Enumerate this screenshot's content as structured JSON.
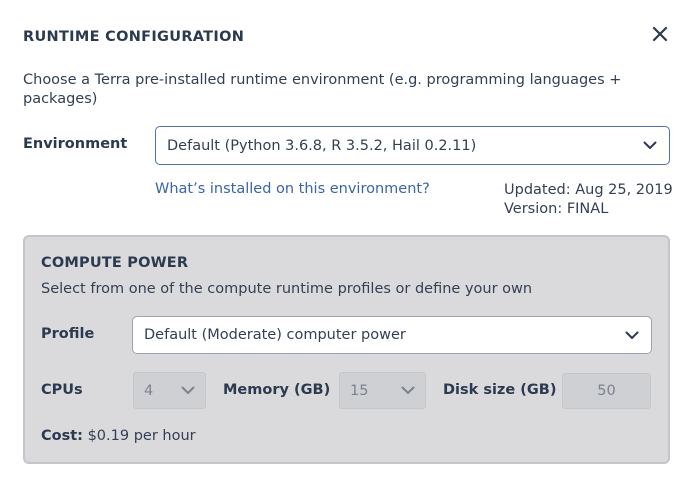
{
  "dialog": {
    "title": "RUNTIME CONFIGURATION",
    "description": "Choose a Terra pre-installed runtime environment (e.g. programming languages + packages)"
  },
  "environment": {
    "label": "Environment",
    "selected": "Default (Python 3.6.8, R 3.5.2, Hail 0.2.11)",
    "info_link": "What’s installed on this environment?",
    "updated": "Updated: Aug 25, 2019",
    "version": "Version: FINAL"
  },
  "compute": {
    "title": "COMPUTE POWER",
    "subtitle": "Select from one of the compute runtime profiles or define your own",
    "profile_label": "Profile",
    "profile_selected": "Default (Moderate) computer power",
    "cpus_label": "CPUs",
    "cpus_value": "4",
    "memory_label": "Memory (GB)",
    "memory_value": "15",
    "disk_label": "Disk size (GB)",
    "disk_value": "50",
    "cost_label": "Cost:",
    "cost_value": "$0.19 per hour"
  },
  "icons": {
    "close": "close-icon",
    "dropdown": "chevron-down-icon"
  },
  "colors": {
    "accent": "#4d72aa",
    "link": "#3a65a8",
    "text": "#333f52",
    "panel_bg": "#dadadd"
  }
}
